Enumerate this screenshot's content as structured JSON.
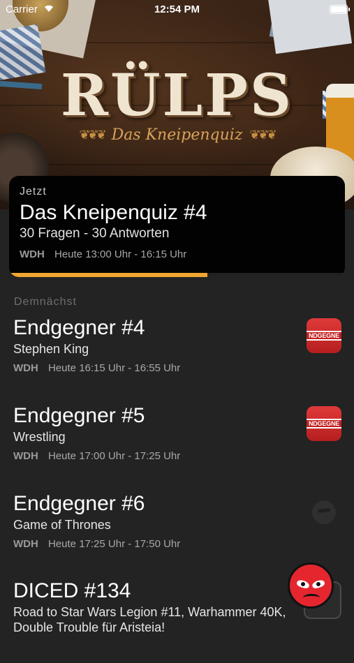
{
  "status_bar": {
    "carrier": "Carrier",
    "time": "12:54 PM"
  },
  "header": {
    "logo_title": "RÜLPS",
    "logo_subtitle": "Das Kneipenquiz",
    "wheat_left": "❦❦❦",
    "wheat_right": "❦❦❦"
  },
  "current": {
    "label": "Jetzt",
    "title": "Das Kneipenquiz #4",
    "subtitle": "30 Fragen - 30 Antworten",
    "channel": "WDH",
    "time": "Heute 13:00 Uhr - 16:15 Uhr",
    "progress_percent": 59,
    "accent_color": "#f0a630"
  },
  "upcoming": {
    "section_label": "Demnächst",
    "items": [
      {
        "title": "Endgegner #4",
        "subtitle": "Stephen King",
        "channel": "WDH",
        "time": "Heute 16:15 Uhr - 16:55 Uhr",
        "logo_icon": "endgegner-logo",
        "logo_text": "NDGEGNE"
      },
      {
        "title": "Endgegner #5",
        "subtitle": "Wrestling",
        "channel": "WDH",
        "time": "Heute 17:00 Uhr - 17:25 Uhr",
        "logo_icon": "endgegner-logo",
        "logo_text": "NDGEGNE"
      },
      {
        "title": "Endgegner #6",
        "subtitle": "Game of Thrones",
        "channel": "WDH",
        "time": "Heute 17:25 Uhr - 17:50 Uhr",
        "logo_icon": "ghost-face-logo"
      },
      {
        "title": "DICED #134",
        "subtitle": "Road to Star Wars Legion #11,  Warhammer 40K, Double Trouble für Aristeia!",
        "logo_icon": "diced-logo"
      }
    ]
  },
  "fab": {
    "icon": "angry-face-icon",
    "color": "#e5262f"
  }
}
